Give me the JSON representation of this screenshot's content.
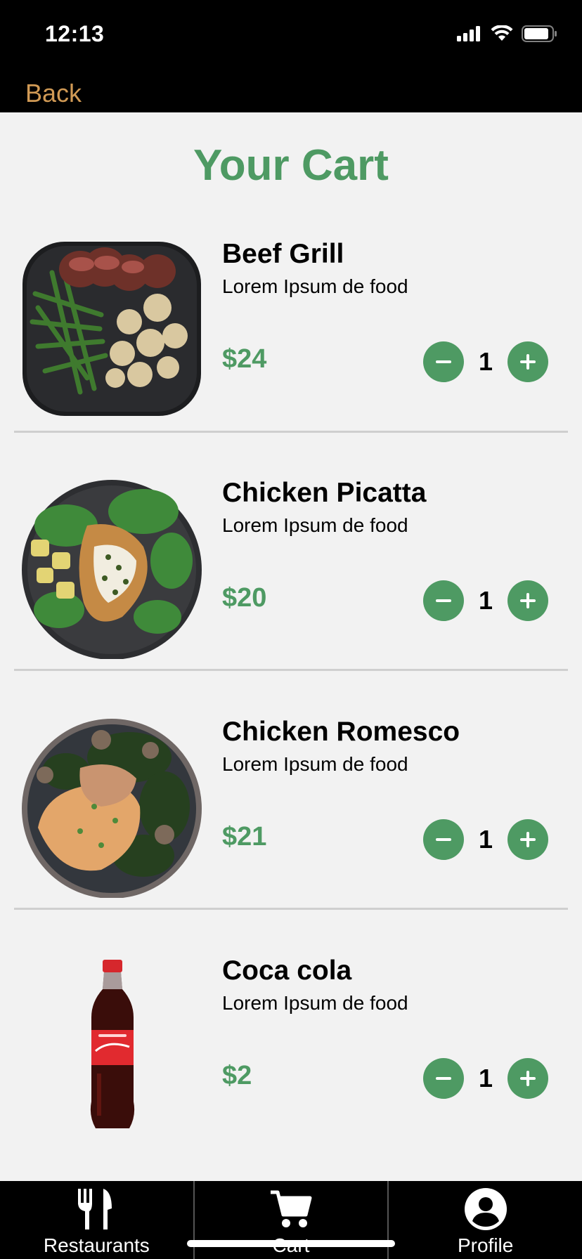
{
  "status_bar": {
    "time": "12:13"
  },
  "nav": {
    "back_label": "Back"
  },
  "page": {
    "title": "Your Cart"
  },
  "colors": {
    "accent": "#4e9a63",
    "back": "#d19a55",
    "background": "#f2f2f2"
  },
  "cart": {
    "items": [
      {
        "name": "Beef Grill",
        "description": "Lorem Ipsum de food",
        "price": "$24",
        "quantity": "1",
        "image": "beef-grill-plate"
      },
      {
        "name": "Chicken Picatta",
        "description": "Lorem Ipsum de food",
        "price": "$20",
        "quantity": "1",
        "image": "chicken-picatta-plate"
      },
      {
        "name": "Chicken Romesco",
        "description": "Lorem Ipsum de food",
        "price": "$21",
        "quantity": "1",
        "image": "chicken-romesco-plate"
      },
      {
        "name": "Coca cola",
        "description": "Lorem Ipsum de food",
        "price": "$2",
        "quantity": "1",
        "image": "coca-cola-bottle"
      }
    ]
  },
  "tabbar": {
    "tabs": [
      {
        "label": "Restaurants",
        "icon": "fork-knife-icon"
      },
      {
        "label": "Cart",
        "icon": "cart-icon"
      },
      {
        "label": "Profile",
        "icon": "user-circle-icon"
      }
    ]
  }
}
